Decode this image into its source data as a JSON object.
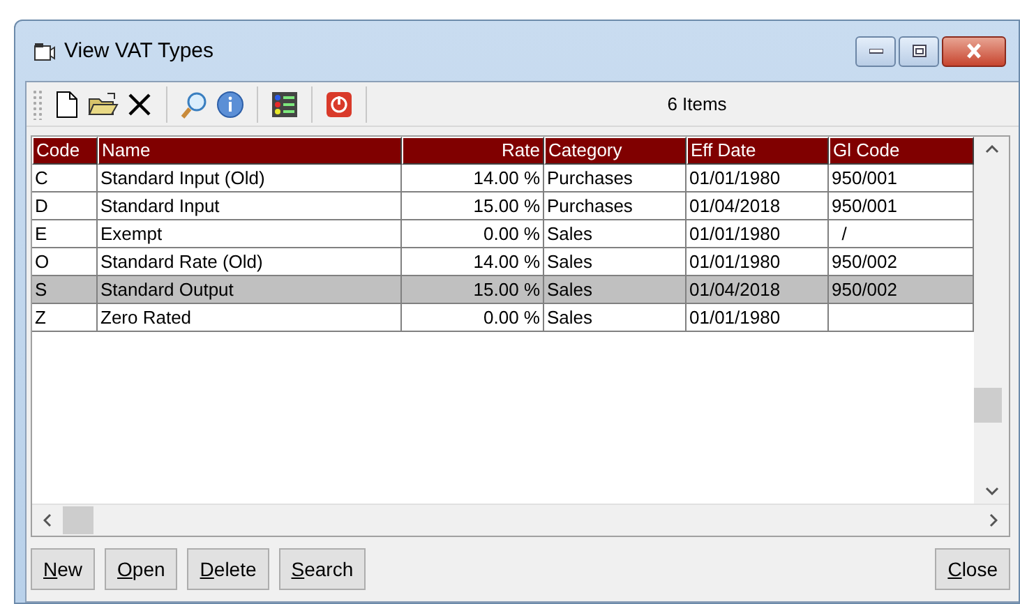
{
  "window": {
    "title": "View VAT Types"
  },
  "toolbar": {
    "count": "6 Items"
  },
  "table": {
    "columns": [
      "Code",
      "Name",
      "Rate",
      "Category",
      "Eff Date",
      "Gl Code"
    ],
    "rows": [
      {
        "cells": [
          "C",
          "Standard Input (Old)",
          "14.00 %",
          "Purchases",
          "01/01/1980",
          "950/001"
        ],
        "selected": false
      },
      {
        "cells": [
          "D",
          "Standard Input",
          "15.00 %",
          "Purchases",
          "01/04/2018",
          "950/001"
        ],
        "selected": false
      },
      {
        "cells": [
          "E",
          "Exempt",
          "0.00 %",
          "Sales",
          "01/01/1980",
          "  /"
        ],
        "selected": false
      },
      {
        "cells": [
          "O",
          "Standard Rate (Old)",
          "14.00 %",
          "Sales",
          "01/01/1980",
          "950/002"
        ],
        "selected": false
      },
      {
        "cells": [
          "S",
          "Standard Output",
          "15.00 %",
          "Sales",
          "01/04/2018",
          "950/002"
        ],
        "selected": true
      },
      {
        "cells": [
          "Z",
          "Zero Rated",
          "0.00 %",
          "Sales",
          "01/01/1980",
          ""
        ],
        "selected": false
      }
    ]
  },
  "buttons": [
    "New",
    "Open",
    "Delete",
    "Search",
    "Close"
  ]
}
